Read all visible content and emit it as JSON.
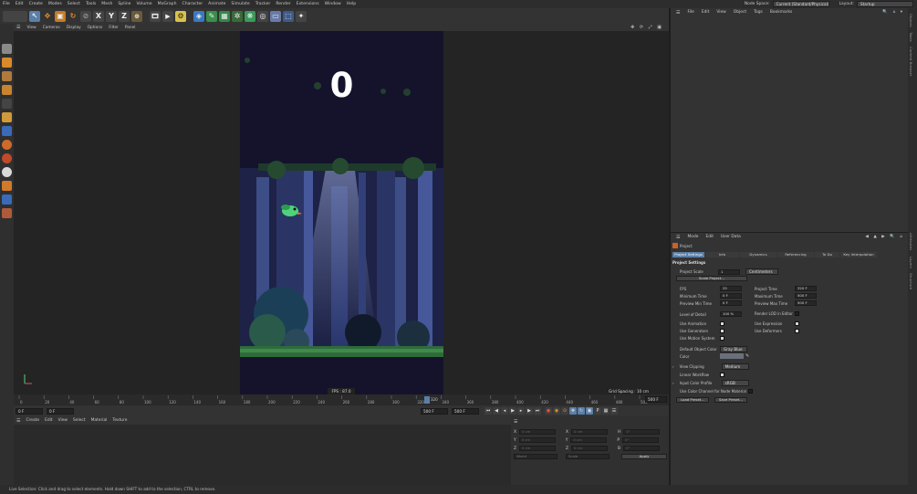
{
  "menubar": {
    "items": [
      "File",
      "Edit",
      "Create",
      "Modes",
      "Select",
      "Tools",
      "Mesh",
      "Spline",
      "Volume",
      "MoGraph",
      "Character",
      "Animate",
      "Simulate",
      "Tracker",
      "Render",
      "Extensions",
      "Window",
      "Help"
    ],
    "node_space_label": "Node Space:",
    "node_space_value": "Current (Standard/Physical)",
    "layout_label": "Layout:",
    "layout_value": "Startup"
  },
  "toolbar": {
    "axis_x": "X",
    "axis_y": "Y",
    "axis_z": "Z"
  },
  "viewport": {
    "menu": [
      "View",
      "Cameras",
      "Display",
      "Options",
      "Filter",
      "Panel"
    ],
    "score": "0",
    "fps": "FPS : 87.0",
    "grid_spacing": "Grid Spacing : 10 cm"
  },
  "timeline": {
    "ticks": [
      "0",
      "20",
      "40",
      "60",
      "80",
      "100",
      "120",
      "140",
      "160",
      "180",
      "200",
      "220",
      "240",
      "260",
      "280",
      "300",
      "320",
      "340",
      "360",
      "380",
      "400",
      "420",
      "440",
      "460",
      "480",
      "500"
    ],
    "current_frame": "320",
    "current_frame_display": "320 F",
    "end_frame": "500 F"
  },
  "transport": {
    "start": "0 F",
    "min": "0 F",
    "max": "500 F",
    "end": "500 F"
  },
  "material_manager": {
    "menu": [
      "Create",
      "Edit",
      "View",
      "Select",
      "Material",
      "Texture"
    ]
  },
  "coordinates": {
    "rows": [
      {
        "a": "X",
        "va": "0 cm",
        "b": "X",
        "vb": "0 cm",
        "c": "H",
        "vc": "0°"
      },
      {
        "a": "Y",
        "va": "0 cm",
        "b": "Y",
        "vb": "0 cm",
        "c": "P",
        "vc": "0°"
      },
      {
        "a": "Z",
        "va": "0 cm",
        "b": "Z",
        "vb": "0 cm",
        "c": "B",
        "vc": "0°"
      }
    ],
    "mode1": "World",
    "mode2": "Scale",
    "apply": "Apply"
  },
  "object_manager": {
    "menu": [
      "File",
      "Edit",
      "View",
      "Object",
      "Tags",
      "Bookmarks"
    ]
  },
  "attribute_manager": {
    "menu": [
      "Mode",
      "Edit",
      "User Data"
    ],
    "object_name": "Project",
    "tabs": [
      "Project Settings",
      "Info",
      "Dynamics",
      "Referencing",
      "To Do",
      "Key Interpolation"
    ],
    "section": "Project Settings",
    "project_scale_label": "Project Scale",
    "project_scale_value": "1",
    "project_scale_unit": "Centimeters",
    "scale_project_btn": "Scale Project...",
    "fps_label": "FPS",
    "fps_value": "25",
    "project_time_label": "Project Time",
    "project_time_value": "320 F",
    "min_time_label": "Minimum Time",
    "min_time_value": "0 F",
    "max_time_label": "Maximum Time",
    "max_time_value": "500 F",
    "prev_min_label": "Preview Min Time",
    "prev_min_value": "0 F",
    "prev_max_label": "Preview Max Time",
    "prev_max_value": "500 F",
    "lod_label": "Level of Detail",
    "lod_value": "100 %",
    "render_lod_label": "Render LOD in Editor",
    "use_anim_label": "Use Animation",
    "use_expr_label": "Use Expression",
    "use_gen_label": "Use Generators",
    "use_def_label": "Use Deformers",
    "use_motion_label": "Use Motion System",
    "default_color_label": "Default Object Color",
    "default_color_value": "Gray Blue",
    "color_label": "Color",
    "view_clip_label": "View Clipping",
    "view_clip_value": "Medium",
    "linear_wf_label": "Linear Workflow",
    "input_color_label": "Input Color Profile",
    "input_color_value": "sRGB",
    "use_color_channel_label": "Use Color Channel for Node Material",
    "load_preset": "Load Preset...",
    "save_preset": "Save Preset..."
  },
  "right_tabs": [
    "Objects",
    "Takes",
    "Content Browser",
    "Attributes",
    "Layers",
    "Structure"
  ],
  "statusbar": {
    "text": "Live Selection: Click and drag to select elements. Hold down SHIFT to add to the selection, CTRL to remove."
  },
  "colors": {
    "accent": "#5a7fa8",
    "game_bg": "#14132b",
    "grass": "#2f6b3a",
    "bird": "#4fd37a"
  }
}
